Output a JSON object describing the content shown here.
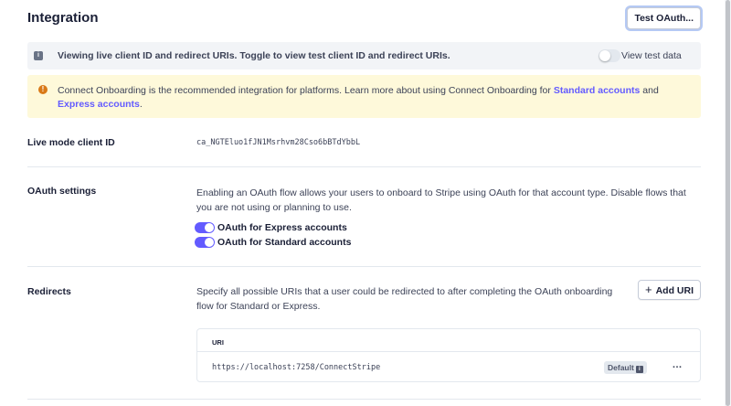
{
  "header": {
    "title": "Integration",
    "test_oauth_label": "Test OAuth..."
  },
  "info_banner": {
    "text": "Viewing live client ID and redirect URIs. Toggle to view test client ID and redirect URIs.",
    "toggle_label": "View test data",
    "toggle_on": false
  },
  "warning_banner": {
    "text_before": "Connect Onboarding is the recommended integration for platforms. Learn more about using Connect Onboarding for ",
    "link_standard": "Standard accounts",
    "text_and": " and ",
    "link_express": "Express accounts",
    "text_end": "."
  },
  "client_id": {
    "label": "Live mode client ID",
    "value": "ca_NGTEluo1fJN1Msrhvm28Cso6bBTdYbbL"
  },
  "oauth": {
    "label": "OAuth settings",
    "description": "Enabling an OAuth flow allows your users to onboard to Stripe using OAuth for that account type. Disable flows that you are not using or planning to use.",
    "toggles": [
      {
        "label": "OAuth for Express accounts",
        "on": true
      },
      {
        "label": "OAuth for Standard accounts",
        "on": true
      }
    ]
  },
  "redirects": {
    "label": "Redirects",
    "description": "Specify all possible URIs that a user could be redirected to after completing the OAuth onboarding flow for Standard or Express.",
    "add_label": "Add URI",
    "table": {
      "header": "URI",
      "rows": [
        {
          "uri": "https://localhost:7258/ConnectStripe",
          "badge": "Default",
          "more": "…"
        }
      ]
    }
  },
  "colors": {
    "accent": "#635bff",
    "warning_bg": "#fef9da",
    "info_bg": "#f2f4f7",
    "warning_icon": "#d97917"
  }
}
